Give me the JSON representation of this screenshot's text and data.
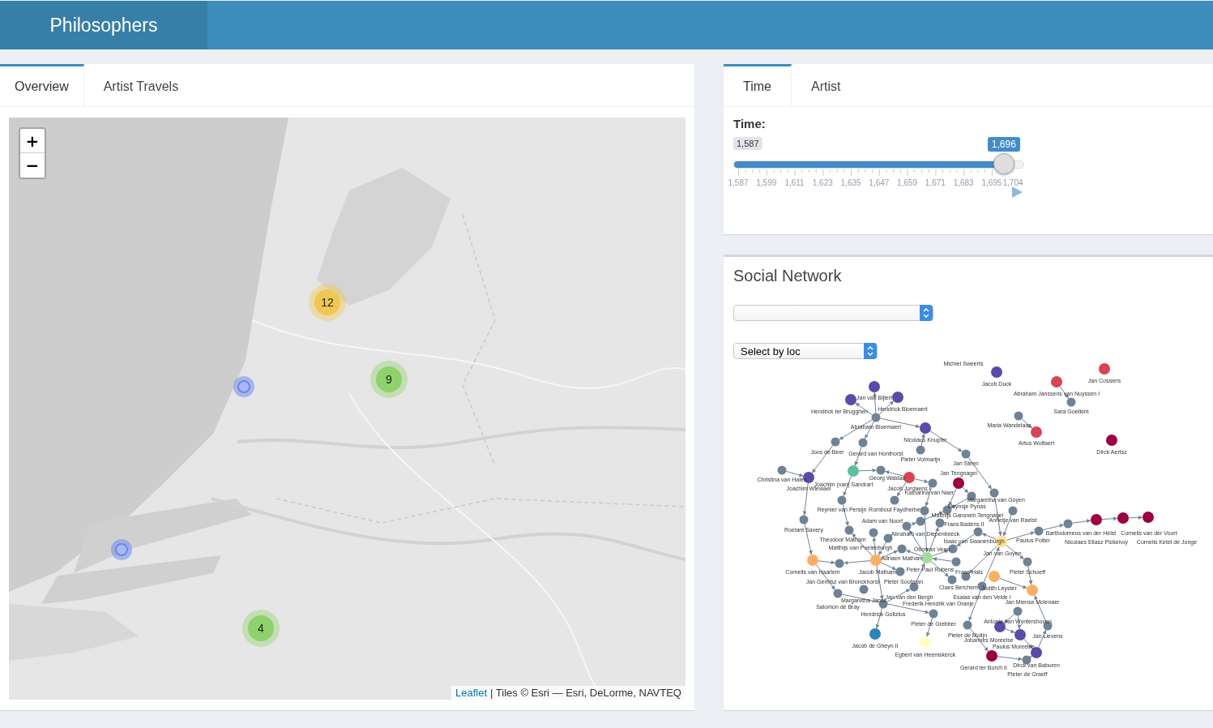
{
  "header": {
    "title": "Philosophers"
  },
  "left_tabs": [
    {
      "label": "Overview",
      "selected": true
    },
    {
      "label": "Artist Travels",
      "selected": false
    }
  ],
  "map": {
    "zoom_in": "+",
    "zoom_out": "−",
    "markers": [
      {
        "kind": "cluster",
        "count": "12",
        "color": "#f0c850"
      },
      {
        "kind": "cluster",
        "count": "9",
        "color": "#8fd16a"
      },
      {
        "kind": "cluster",
        "count": "4",
        "color": "#8fd16a"
      },
      {
        "kind": "point"
      },
      {
        "kind": "point"
      }
    ],
    "attribution": {
      "link": "Leaflet",
      "text": "| Tiles © Esri — Esri, DeLorme, NAVTEQ"
    }
  },
  "right_tabs": [
    {
      "label": "Time",
      "selected": true
    },
    {
      "label": "Artist",
      "selected": false
    }
  ],
  "time_slider": {
    "label": "Time:",
    "min_label": "1,587",
    "value_label": "1,696",
    "level": 0.93,
    "tick_labels": [
      "1,587",
      "1,599",
      "1,611",
      "1,623",
      "1,635",
      "1,647",
      "1,659",
      "1,671",
      "1,683",
      "1,695",
      "1,704"
    ]
  },
  "network": {
    "title": "Social Network",
    "filters": [
      {
        "kind": "blank"
      },
      {
        "kind": "location",
        "value": "Select by loc"
      }
    ],
    "nodes": [
      {
        "label": "Michiel Sweerts"
      },
      {
        "label": "Jacob Duck",
        "color": "#5b4ba8"
      },
      {
        "label": "Jan Cossiers",
        "color": "#d94352"
      },
      {
        "label": "Abraham Janssens van Nuyssen I",
        "color": "#d94352"
      },
      {
        "label": "Sara Goetkint",
        "color": "#6f8296"
      },
      {
        "label": "Maria Wandelaar",
        "color": "#6f8296"
      },
      {
        "label": "Artus Wolfaert",
        "color": "#d94352"
      },
      {
        "label": "Dirck Aertsz",
        "color": "#9e0142"
      },
      {
        "label": "Jan van Bijlert",
        "color": "#5b4ba8"
      },
      {
        "label": "Hendrick ter Brugghen",
        "color": "#5b4ba8"
      },
      {
        "label": "Hendrick Bloemaert",
        "color": "#5b4ba8"
      },
      {
        "label": "Abraham Bloemaert",
        "color": "#6f8296"
      },
      {
        "label": "Nicolaus Knupfer",
        "color": "#5b4ba8"
      },
      {
        "label": "Joos de Beer",
        "color": "#6f8296"
      },
      {
        "label": "Gerard van Honthorst",
        "color": "#6f8296"
      },
      {
        "label": "Pieter Volmarijn",
        "color": "#6f8296"
      },
      {
        "label": "Jan Steen",
        "color": "#6f8296"
      },
      {
        "label": "Christina van Halen",
        "color": "#6f8296"
      },
      {
        "label": "Joachim Wtewael",
        "color": "#5b4ba8"
      },
      {
        "label": "Joachim (van) Sandrart",
        "color": "#5cc0a0"
      },
      {
        "label": "Georg Waldau",
        "color": "#6f8296"
      },
      {
        "label": "Jacob Jordaens I",
        "color": "#d94352"
      },
      {
        "label": "Katharina van Naer",
        "color": "#6f8296"
      },
      {
        "label": "Jan Tengnagel",
        "color": "#9e0142"
      },
      {
        "color": "#6f8296"
      },
      {
        "label": "Meynsje Pynas",
        "color": "#6f8296"
      },
      {
        "label": "Margaretha van Goyen",
        "color": "#6f8296"
      },
      {
        "label": "Annetje van Raelst",
        "color": "#6f8296"
      },
      {
        "label": "Reynier van Persijn",
        "color": "#6f8296"
      },
      {
        "label": "Rombout Faydherbe",
        "color": "#6f8296"
      },
      {
        "color": "#6f8296"
      },
      {
        "label": "Adam van Noort",
        "color": "#6f8296"
      },
      {
        "label": "Matthijs Gansneb Tengnagel",
        "color": "#6f8296"
      },
      {
        "label": "Roelant Savery",
        "color": "#6f8296"
      },
      {
        "label": "Theodoor Matham",
        "color": "#6f8296"
      },
      {
        "label": "Matthijs van Poelenburgh",
        "color": "#6f8296"
      },
      {
        "label": "Abraham van Diepenbeeck",
        "color": "#6f8296"
      },
      {
        "label": "Isaac van Swanenburgh",
        "color": "#6f8296"
      },
      {
        "label": "Otto van Veen",
        "color": "#6f8296"
      },
      {
        "label": "Jan van Goyen",
        "color": "#fee08b"
      },
      {
        "label": "Paulus Potter",
        "color": "#6f8296"
      },
      {
        "label": "Bartholomeus van der Helst",
        "color": "#6f8296"
      },
      {
        "label": "Nicolaes Eliasz Pickenoy",
        "color": "#9e0142"
      },
      {
        "label": "Cornelis van der Voort",
        "color": "#9e0142"
      },
      {
        "label": "Cornelis Ketel de Jonge",
        "color": "#9e0142"
      },
      {
        "label": "Cornelis van Haarlem",
        "color": "#fdae61"
      },
      {
        "label": "Jan Gerritsz van Bronckhorst",
        "color": "#6f8296"
      },
      {
        "label": "Jacob Matham",
        "color": "#fdae61"
      },
      {
        "label": "Adriaen Matham",
        "color": "#6f8296"
      },
      {
        "label": "Peter Paul Rubens",
        "color": "#a6dba0"
      },
      {
        "label": "Pieter Soutman",
        "color": "#6f8296"
      },
      {
        "label": "Frans Hals",
        "color": "#6f8296"
      },
      {
        "label": "Claes Berchem",
        "color": "#6f8296"
      },
      {
        "label": "Frederik Hendrik van Oranje",
        "color": "#6f8296"
      },
      {
        "label": "Judith Leyster",
        "color": "#fdae61"
      },
      {
        "label": "Esaias van den Velde I",
        "color": "#6f8296"
      },
      {
        "label": "Pieter Schoeff",
        "color": "#6f8296"
      },
      {
        "label": "Jan Miense Molenaer",
        "color": "#fdae61"
      },
      {
        "label": "Jan van den Bergh",
        "color": "#6f8296"
      },
      {
        "label": "Margaretha Jansz",
        "color": "#6f8296"
      },
      {
        "label": "Salomon de Bray",
        "color": "#6f8296"
      },
      {
        "label": "Hendrick Goltzius",
        "color": "#6f8296"
      },
      {
        "label": "Pieter de Grebber",
        "color": "#6f8296"
      },
      {
        "label": "Jacob de Gheyn II",
        "color": "#2b83ba"
      },
      {
        "label": "Egbert van Heemskerck",
        "color": "#ffffbf"
      },
      {
        "label": "Pieter de Molijn",
        "color": "#6f8296"
      },
      {
        "label": "Antonie van Wyntershoven",
        "color": "#6f8296"
      },
      {
        "label": "Johannes Moreelse",
        "color": "#5b4ba8"
      },
      {
        "label": "Paulus Moreelse",
        "color": "#5b4ba8"
      },
      {
        "label": "Jan Lievens",
        "color": "#6f8296"
      },
      {
        "label": "Dirck van Baburen",
        "color": "#5b4ba8"
      },
      {
        "label": "Gerard ter Borch II",
        "color": "#9e0142"
      },
      {
        "label": "Pieter de Graeff",
        "color": "#6f8296"
      },
      {
        "label": "Frans Badens II",
        "color": "#6f8296"
      }
    ]
  }
}
